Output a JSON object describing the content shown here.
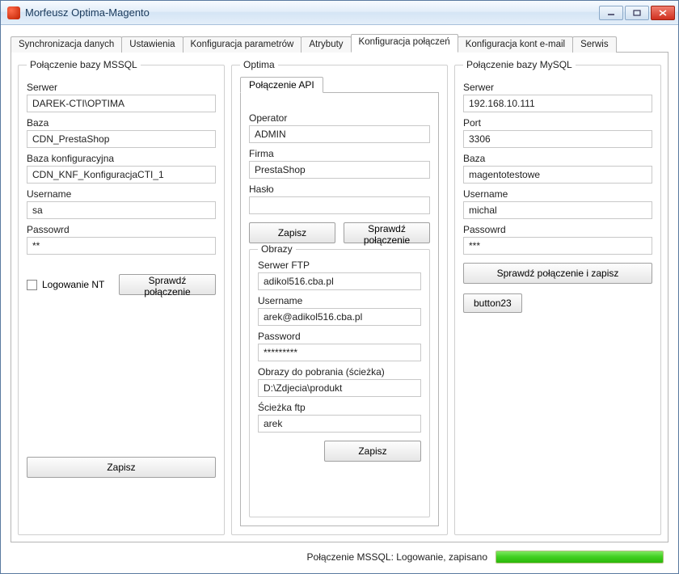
{
  "titlebar": {
    "title": "Morfeusz Optima-Magento"
  },
  "tabs": {
    "sync": "Synchronizacja danych",
    "settings": "Ustawienia",
    "params": "Konfiguracja parametrów",
    "attrs": "Atrybuty",
    "conn": "Konfiguracja połączeń",
    "email": "Konfiguracja kont e-mail",
    "service": "Serwis"
  },
  "mssql": {
    "legend": "Połączenie bazy MSSQL",
    "server_label": "Serwer",
    "server": "DAREK-CTI\\OPTIMA",
    "db_label": "Baza",
    "db": "CDN_PrestaShop",
    "cfg_label": "Baza konfiguracyjna",
    "cfg": "CDN_KNF_KonfiguracjaCTI_1",
    "user_label": "Username",
    "user": "sa",
    "pass_label": "Passowrd",
    "pass": "**",
    "nt_label": "Logowanie NT",
    "check": "Sprawdź połączenie",
    "save": "Zapisz"
  },
  "optima": {
    "legend": "Optima",
    "api_tab": "Połączenie API",
    "operator_label": "Operator",
    "operator": "ADMIN",
    "firma_label": "Firma",
    "firma": "PrestaShop",
    "haslo_label": "Hasło",
    "haslo": "",
    "save": "Zapisz",
    "check": "Sprawdź połączenie",
    "images_legend": "Obrazy",
    "ftp_server_label": "Serwer FTP",
    "ftp_server": "adikol516.cba.pl",
    "ftp_user_label": "Username",
    "ftp_user": "arek@adikol516.cba.pl",
    "ftp_pass_label": "Password",
    "ftp_pass": "*********",
    "img_path_label": "Obrazy do pobrania (ścieżka)",
    "img_path": "D:\\Zdjecia\\produkt",
    "ftp_path_label": "Ścieżka ftp",
    "ftp_path": "arek",
    "images_save": "Zapisz"
  },
  "mysql": {
    "legend": "Połączenie bazy MySQL",
    "server_label": "Serwer",
    "server": "192.168.10.111",
    "port_label": "Port",
    "port": "3306",
    "db_label": "Baza",
    "db": "magentotestowe",
    "user_label": "Username",
    "user": "michal",
    "pass_label": "Passowrd",
    "pass": "***",
    "check_save": "Sprawdź połączenie i zapisz",
    "button23": "button23"
  },
  "status": {
    "text": "Połączenie MSSQL: Logowanie, zapisano"
  }
}
